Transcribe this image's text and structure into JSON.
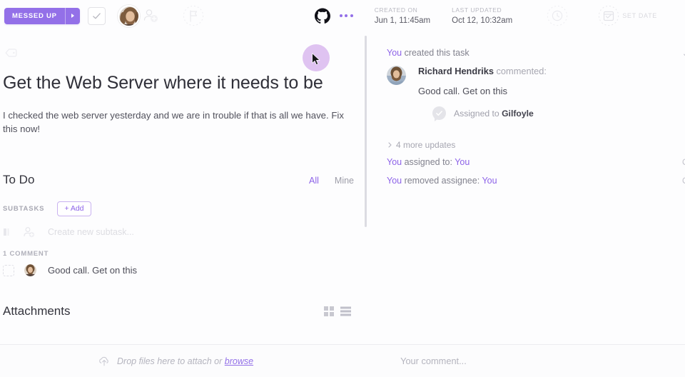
{
  "topbar": {
    "status_label": "MESSED UP",
    "status_color": "#9370e8",
    "caret_icon": "caret-right-icon",
    "check_icon": "checkmark-icon",
    "avatar_icon": "user-avatar",
    "add_person_icon": "add-person-icon",
    "flag_icon": "flag-icon",
    "github_icon": "github-icon",
    "more_icon": "ellipsis-icon",
    "created": {
      "label": "CREATED ON",
      "value": "Jun 1, 11:45am"
    },
    "updated": {
      "label": "LAST UPDATED",
      "value": "Oct 12, 10:32am"
    },
    "clock_icon": "clock-icon",
    "calendar_icon": "calendar-check-icon",
    "set_date_label": "SET DATE"
  },
  "task": {
    "tag_icon": "tag-icon",
    "title": "Get the Web Server where it needs to be",
    "description": "I checked the web server yesterday and we are in trouble if that is all we have. Fix this now!"
  },
  "todo": {
    "heading": "To Do",
    "filters": [
      {
        "label": "All",
        "active": true
      },
      {
        "label": "Mine",
        "active": false
      }
    ],
    "subtasks_label": "SUBTASKS",
    "add_label": "+ Add",
    "new_subtask_placeholder": "Create new subtask...",
    "list_icon": "list-icon",
    "assignee_icon": "assign-person-icon"
  },
  "comments": {
    "count_label": "1 COMMENT",
    "items": [
      {
        "text": "Good call. Get on this",
        "avatar": "richard-avatar"
      }
    ]
  },
  "attachments": {
    "heading": "Attachments",
    "grid_view_icon": "grid-view-icon",
    "list_view_icon": "list-view-icon"
  },
  "activity": {
    "created": {
      "actor": "You",
      "text": " created this task",
      "time": "J"
    },
    "comment": {
      "author": "Richard Hendriks",
      "verb": " commented:",
      "message": "Good call. Get on this",
      "assigned_prefix": "Assigned to ",
      "assignee": "Gilfoyle",
      "check_icon": "check-bubble-icon"
    },
    "more_updates": {
      "label": "4 more updates",
      "chevron_icon": "chevron-right-icon"
    },
    "rows": [
      {
        "actor": "You",
        "text": " assigned to: ",
        "target": "You",
        "time": "O"
      },
      {
        "actor": "You",
        "text": " removed assignee: ",
        "target": "You",
        "time": "O"
      }
    ]
  },
  "bottombar": {
    "upload_icon": "upload-cloud-icon",
    "drop_text": "Drop files here to attach or ",
    "browse_label": "browse",
    "comment_placeholder": "Your comment..."
  },
  "cursor": {
    "icon": "mouse-pointer-icon",
    "halo_color": "#d9b9ef"
  }
}
